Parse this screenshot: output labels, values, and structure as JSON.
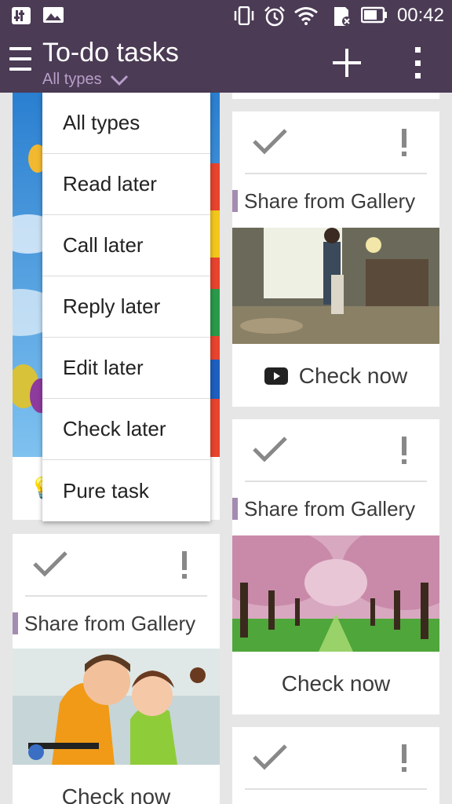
{
  "status_bar": {
    "time": "00:42",
    "icons": [
      "equalizer-icon",
      "image-icon",
      "vibrate-icon",
      "alarm-icon",
      "wifi-icon",
      "sd-card-icon",
      "battery-icon"
    ]
  },
  "app_bar": {
    "title": "To-do tasks",
    "filter": "All types",
    "actions": [
      "add-icon",
      "overflow-menu-icon"
    ]
  },
  "filter_menu": {
    "items": [
      "All types",
      "Read later",
      "Call later",
      "Reply later",
      "Edit later",
      "Check later",
      "Pure task"
    ]
  },
  "cards": {
    "left_bottom": {
      "label": "Share from Gallery",
      "footer": "Check now"
    },
    "right_1": {
      "label": "Share from Gallery",
      "footer": "Check now",
      "footer_icon": "youtube-icon"
    },
    "right_2": {
      "label": "Share from Gallery",
      "footer": "Check now"
    }
  },
  "colors": {
    "header": "#4b3b55",
    "accent": "#a48bb1",
    "subtitle": "#b89ec9"
  }
}
